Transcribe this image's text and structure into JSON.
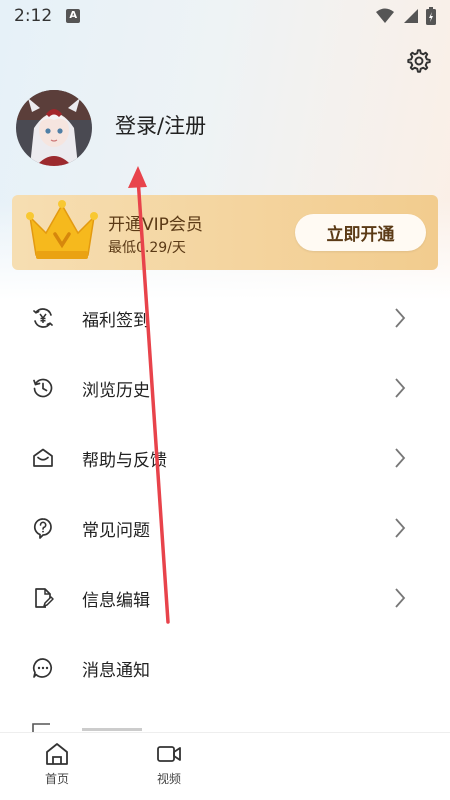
{
  "status_bar": {
    "time": "2:12",
    "notif_icon": "A"
  },
  "profile": {
    "login_label": "登录/注册"
  },
  "vip": {
    "title": "开通VIP会员",
    "subtitle": "最低0.29/天",
    "button_label": "立即开通",
    "accent": "#f2cc8e"
  },
  "menu": {
    "items": [
      {
        "label": "福利签到",
        "icon": "yen-refresh-icon"
      },
      {
        "label": "浏览历史",
        "icon": "history-icon"
      },
      {
        "label": "帮助与反馈",
        "icon": "mail-open-icon"
      },
      {
        "label": "常见问题",
        "icon": "question-bubble-icon"
      },
      {
        "label": "信息编辑",
        "icon": "edit-doc-icon"
      },
      {
        "label": "消息通知",
        "icon": "chat-dots-icon"
      }
    ]
  },
  "tabbar": {
    "tabs": [
      {
        "label": "首页",
        "icon": "home-icon"
      },
      {
        "label": "视频",
        "icon": "video-icon"
      }
    ]
  },
  "annotation_color": "#e8434b"
}
